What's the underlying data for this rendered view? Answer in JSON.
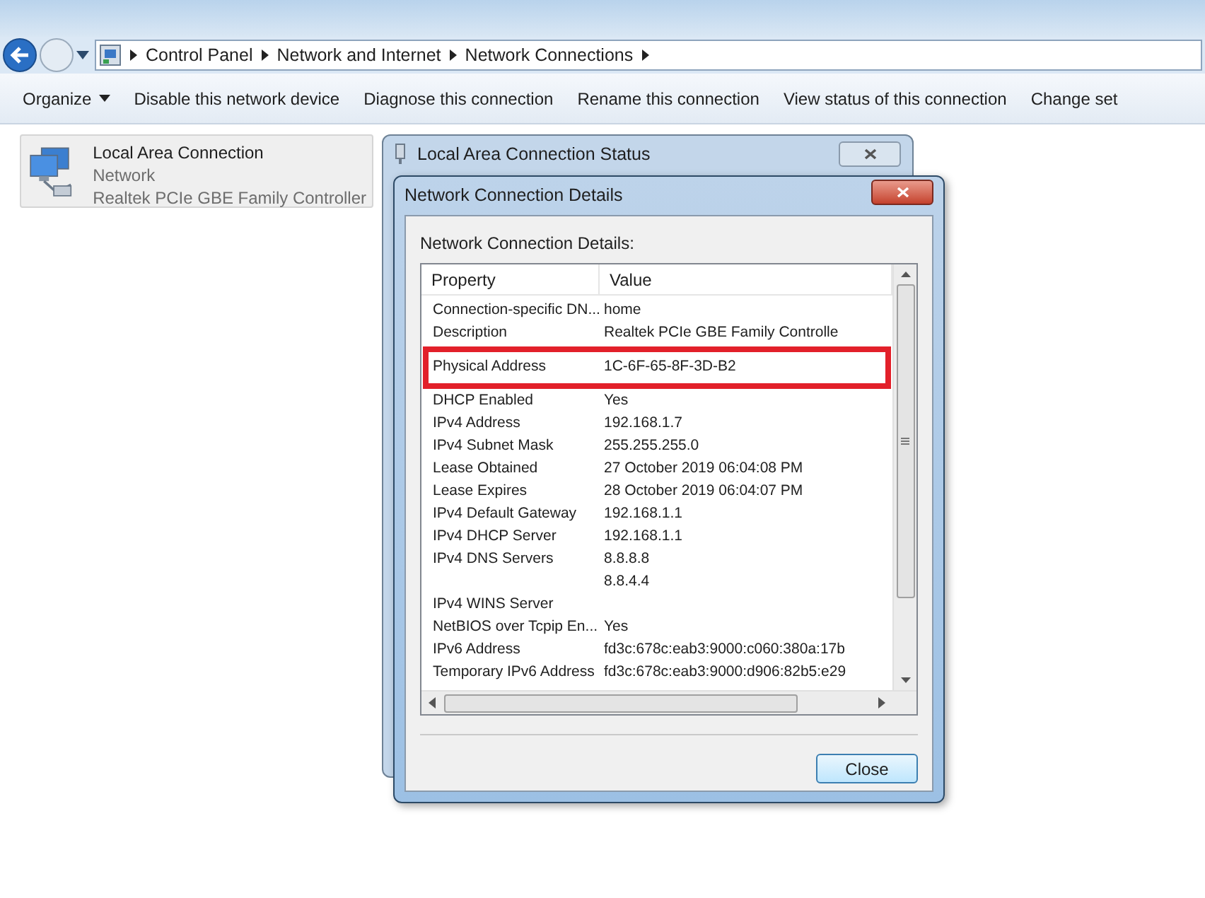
{
  "address_bar": {
    "breadcrumb": [
      "Control Panel",
      "Network and Internet",
      "Network Connections"
    ]
  },
  "toolbar": {
    "items": [
      {
        "label": "Organize",
        "kind": "menu"
      },
      {
        "label": "Disable this network device",
        "kind": "button"
      },
      {
        "label": "Diagnose this connection",
        "kind": "button"
      },
      {
        "label": "Rename this connection",
        "kind": "button"
      },
      {
        "label": "View status of this connection",
        "kind": "button"
      },
      {
        "label": "Change set",
        "kind": "button"
      }
    ]
  },
  "connections": [
    {
      "name": "Local Area Connection",
      "network": "Network",
      "device": "Realtek PCIe GBE Family Controller",
      "selected": true
    }
  ],
  "status_window": {
    "title": "Local Area Connection Status"
  },
  "details_dialog": {
    "title": "Network Connection Details",
    "list_label": "Network Connection Details:",
    "columns": [
      "Property",
      "Value"
    ],
    "rows": [
      {
        "property": "Connection-specific DN...",
        "value": "home",
        "highlighted": false
      },
      {
        "property": "Description",
        "value": "Realtek PCIe GBE Family Controlle",
        "highlighted": false
      },
      {
        "property": "Physical Address",
        "value": "1C-6F-65-8F-3D-B2",
        "highlighted": true
      },
      {
        "property": "DHCP Enabled",
        "value": "Yes",
        "highlighted": false
      },
      {
        "property": "IPv4 Address",
        "value": "192.168.1.7",
        "highlighted": false
      },
      {
        "property": "IPv4 Subnet Mask",
        "value": "255.255.255.0",
        "highlighted": false
      },
      {
        "property": "Lease Obtained",
        "value": "27 October 2019 06:04:08 PM",
        "highlighted": false
      },
      {
        "property": "Lease Expires",
        "value": "28 October 2019 06:04:07 PM",
        "highlighted": false
      },
      {
        "property": "IPv4 Default Gateway",
        "value": "192.168.1.1",
        "highlighted": false
      },
      {
        "property": "IPv4 DHCP Server",
        "value": "192.168.1.1",
        "highlighted": false
      },
      {
        "property": "IPv4 DNS Servers",
        "value": "8.8.8.8",
        "highlighted": false
      },
      {
        "value": "8.8.4.4",
        "highlighted": false
      },
      {
        "property": "IPv4 WINS Server",
        "highlighted": false
      },
      {
        "property": "NetBIOS over Tcpip En...",
        "value": "Yes",
        "highlighted": false
      },
      {
        "property": "IPv6 Address",
        "value": "fd3c:678c:eab3:9000:c060:380a:17b",
        "highlighted": false
      },
      {
        "property": "Temporary IPv6 Address",
        "value": "fd3c:678c:eab3:9000:d906:82b5:e29",
        "highlighted": false
      }
    ],
    "close_button": "Close"
  }
}
